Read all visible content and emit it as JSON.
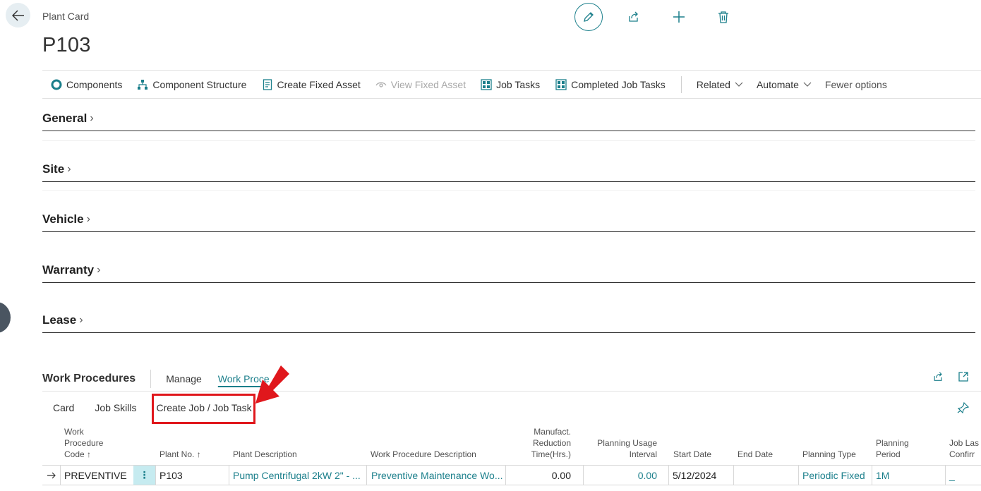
{
  "header": {
    "breadcrumb": "Plant Card",
    "title": "P103"
  },
  "actions": {
    "components": "Components",
    "component_structure": "Component Structure",
    "create_fixed_asset": "Create Fixed Asset",
    "view_fixed_asset": "View Fixed Asset",
    "job_tasks": "Job Tasks",
    "completed_job_tasks": "Completed Job Tasks",
    "related": "Related",
    "automate": "Automate",
    "fewer_options": "Fewer options"
  },
  "fasttabs": [
    "General",
    "Site",
    "Vehicle",
    "Warranty",
    "Lease"
  ],
  "part": {
    "title": "Work Procedures",
    "tab_manage": "Manage",
    "tab_work_procedure": "Work Proce",
    "sub_card": "Card",
    "sub_job_skills": "Job Skills",
    "sub_create_job": "Create Job / Job Task"
  },
  "grid": {
    "headers": {
      "wp_code_1": "Work",
      "wp_code_2": "Procedure",
      "wp_code_3": "Code ↑",
      "plant_no": "Plant No. ↑",
      "plant_desc": "Plant Description",
      "wp_desc": "Work Procedure Description",
      "manuf_1": "Manufact.",
      "manuf_2": "Reduction",
      "manuf_3": "Time(Hrs.)",
      "usage_1": "Planning Usage",
      "usage_2": "Interval",
      "start_date": "Start Date",
      "end_date": "End Date",
      "planning_type": "Planning Type",
      "period_1": "Planning",
      "period_2": "Period",
      "job_last_1": "Job Las",
      "job_last_2": "Confirr"
    },
    "row": {
      "code": "PREVENTIVE",
      "menu": "⋮",
      "plant_no": "P103",
      "plant_desc": "Pump Centrifugal 2kW 2\" - ...",
      "wp_desc": "Preventive Maintenance Wo...",
      "manuf": "0.00",
      "usage": "0.00",
      "start_date": "5/12/2024",
      "end_date": "",
      "planning_type": "Periodic Fixed",
      "period": "1M",
      "job_last": "_"
    }
  },
  "colors": {
    "accent": "#1b7f8b",
    "highlight": "#e0171c"
  }
}
